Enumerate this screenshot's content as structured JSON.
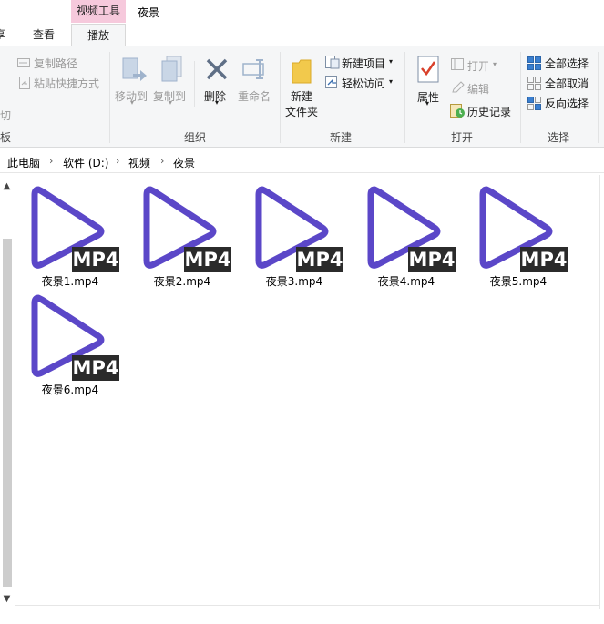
{
  "tabs": {
    "share_partial": "享",
    "view": "查看",
    "context_header": "视频工具",
    "play": "播放",
    "folder_title": "夜景"
  },
  "ribbon": {
    "clipboard": {
      "copy_path": "复制路径",
      "paste_shortcut": "粘贴快捷方式",
      "cut_partial": "切",
      "group_partial": "板"
    },
    "organize": {
      "move_to": "移动到",
      "copy_to": "复制到",
      "delete": "删除",
      "rename": "重命名",
      "label": "组织"
    },
    "new": {
      "new_folder_line1": "新建",
      "new_folder_line2": "文件夹",
      "new_item": "新建项目",
      "easy_access": "轻松访问",
      "label": "新建"
    },
    "open": {
      "properties": "属性",
      "open": "打开",
      "edit": "编辑",
      "history": "历史记录",
      "label": "打开"
    },
    "select": {
      "select_all": "全部选择",
      "select_none": "全部取消",
      "invert": "反向选择",
      "label": "选择"
    }
  },
  "breadcrumb": [
    "此电脑",
    "软件 (D:)",
    "视频",
    "夜景"
  ],
  "files": [
    {
      "name": "夜景1.mp4",
      "badge": "MP4"
    },
    {
      "name": "夜景2.mp4",
      "badge": "MP4"
    },
    {
      "name": "夜景3.mp4",
      "badge": "MP4"
    },
    {
      "name": "夜景4.mp4",
      "badge": "MP4"
    },
    {
      "name": "夜景5.mp4",
      "badge": "MP4"
    },
    {
      "name": "夜景6.mp4",
      "badge": "MP4"
    }
  ],
  "colors": {
    "context_tab": "#f6c9dc",
    "play_icon": "#5b47c8",
    "badge_bg": "#2b2b2b"
  },
  "icons": {
    "play": "play-triangle-icon",
    "scroll_up": "▲",
    "scroll_down": "▼",
    "chevron": "›"
  }
}
